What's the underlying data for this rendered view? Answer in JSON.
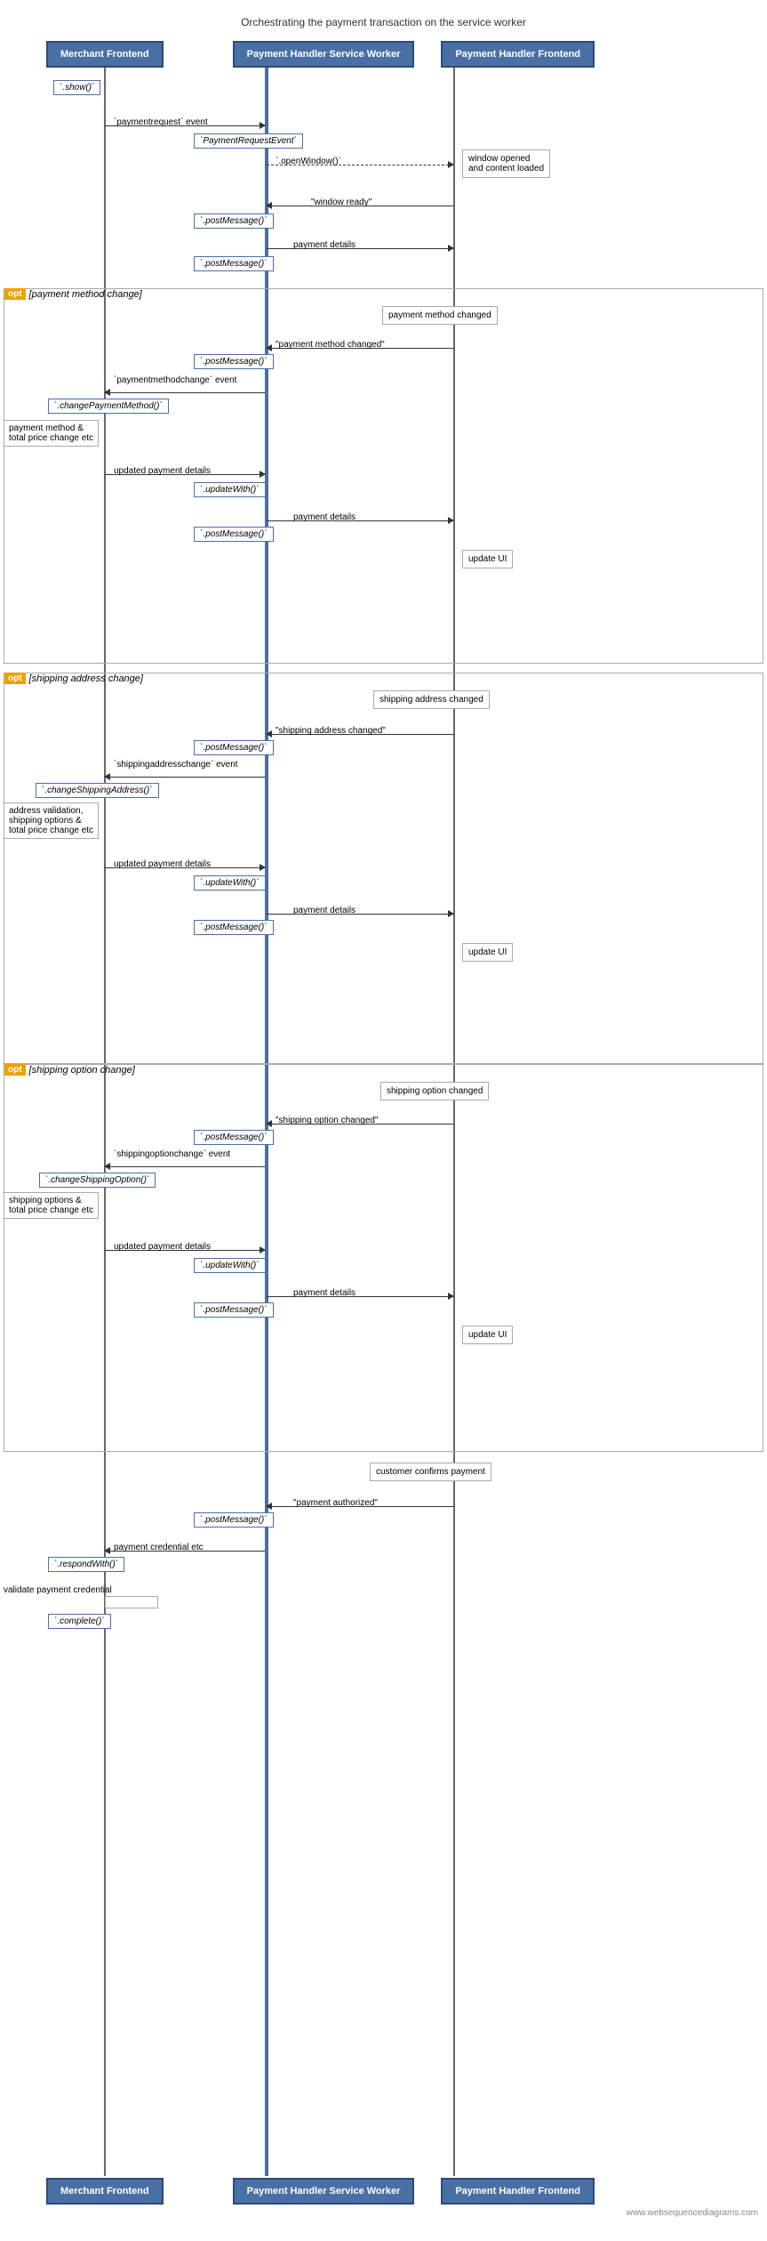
{
  "title": "Orchestrating the payment transaction on the service worker",
  "actors": [
    {
      "label": "Merchant Frontend",
      "id": "merchant"
    },
    {
      "label": "Payment Handler Service Worker",
      "id": "sw"
    },
    {
      "label": "Payment Handler Frontend",
      "id": "frontend"
    }
  ],
  "footer_credit": "www.websequencediagrams.com",
  "top_actor_labels": {
    "merchant": "Merchant Frontend",
    "sw": "Payment Handler Service Worker",
    "frontend": "Payment Handler Frontend"
  },
  "opt_sections": [
    {
      "label": "[payment method change]"
    },
    {
      "label": "[shipping address change]"
    },
    {
      "label": "[shipping option change]"
    }
  ]
}
